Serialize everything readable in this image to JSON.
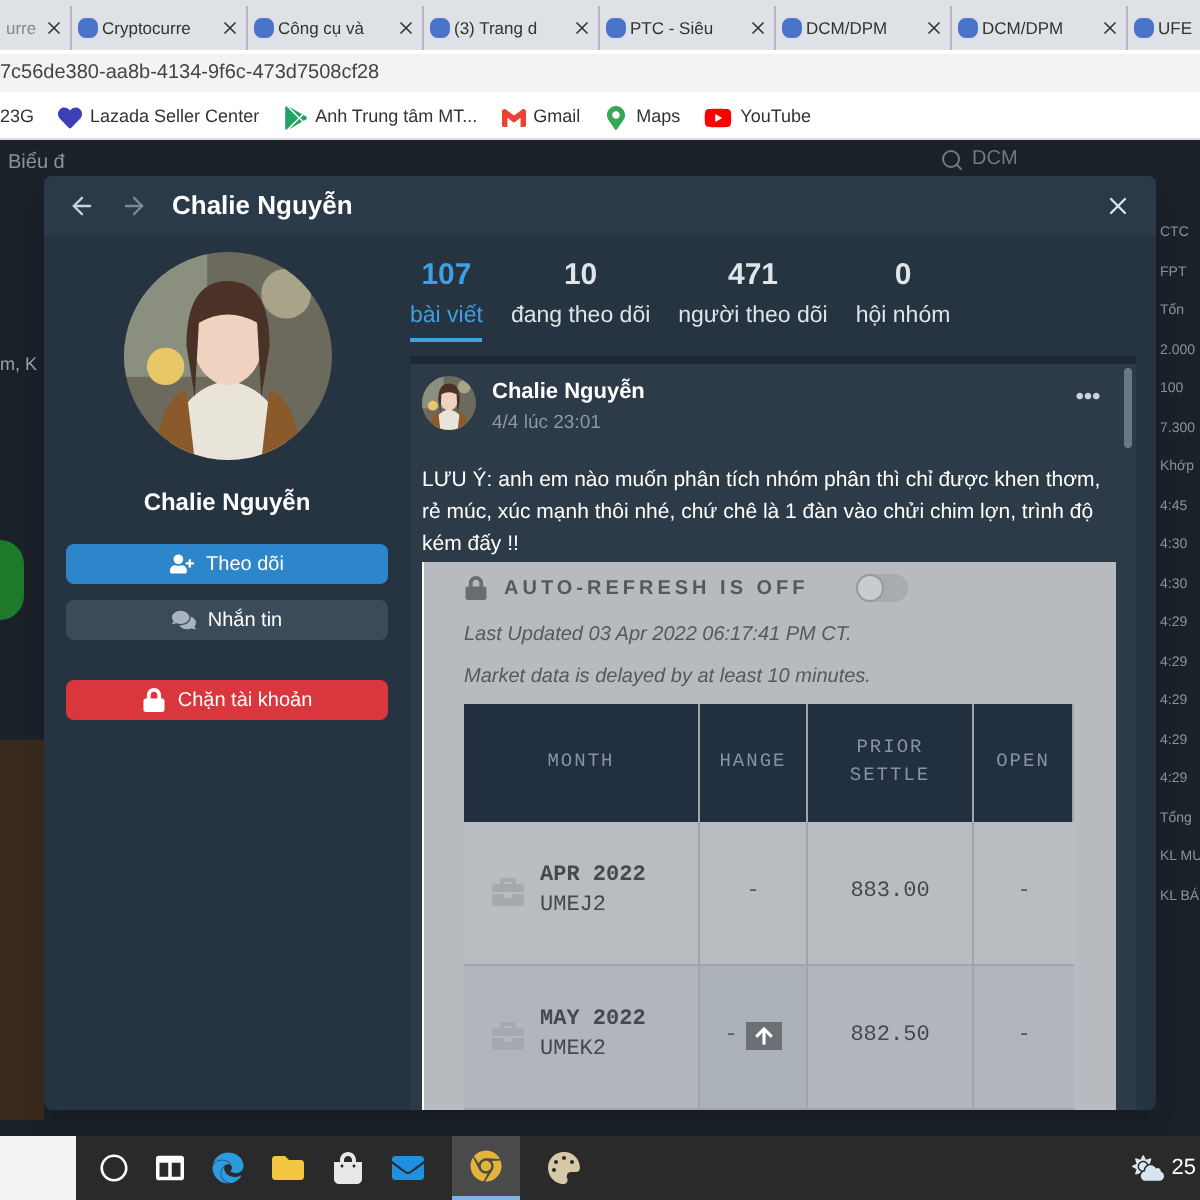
{
  "browser": {
    "tabs": [
      {
        "title": "urre",
        "selected": false
      },
      {
        "title": "Cryptocurre",
        "selected": false
      },
      {
        "title": "Công cụ và",
        "selected": false
      },
      {
        "title": "(3) Trang d",
        "selected": false
      },
      {
        "title": "PTC - Siêu",
        "selected": false
      },
      {
        "title": "DCM/DPM",
        "selected": false
      },
      {
        "title": "DCM/DPM",
        "selected": false
      },
      {
        "title": "UFE",
        "selected": false
      }
    ],
    "address": "7c56de380-aa8b-4134-9f6c-473d7508cf28",
    "bookmarks": [
      {
        "label": "23G",
        "kind": "none"
      },
      {
        "label": "Lazada Seller Center",
        "kind": "heart"
      },
      {
        "label": "Anh Trung tâm MT...",
        "kind": "drive"
      },
      {
        "label": "Gmail",
        "kind": "gmail"
      },
      {
        "label": "Maps",
        "kind": "maps"
      },
      {
        "label": "YouTube",
        "kind": "youtube"
      }
    ]
  },
  "background": {
    "top_left": "Biểu đ",
    "side_text": "m, K",
    "search": "DCM",
    "right_column": [
      "CTC",
      "FPT",
      "Tổn",
      "2.000",
      "100",
      "7.300",
      "Khớp",
      "4:45",
      "4:30",
      "4:30",
      "4:29",
      "4:29",
      "4:29",
      "4:29",
      "4:29",
      "Tổng",
      "KL MU",
      "KL BÁ"
    ]
  },
  "modal": {
    "title": "Chalie Nguyễn",
    "name": "Chalie Nguyễn",
    "buttons": [
      {
        "label": "Theo dõi",
        "kind": "follow"
      },
      {
        "label": "Nhắn tin",
        "kind": "message"
      },
      {
        "label": "Chặn tài khoản",
        "kind": "block"
      }
    ],
    "stats": [
      {
        "value": "107",
        "label": "bài viết",
        "selected": true
      },
      {
        "value": "10",
        "label": "đang theo dõi",
        "selected": false
      },
      {
        "value": "471",
        "label": "người theo dõi",
        "selected": false
      },
      {
        "value": "0",
        "label": "hội nhóm",
        "selected": false
      }
    ],
    "post": {
      "author": "Chalie Nguyễn",
      "time": "4/4 lúc 23:01",
      "text": "LƯU Ý: anh em nào muốn phân tích nhóm phân thì chỉ được khen thơm, rẻ múc, xúc mạnh thôi nhé, chứ chê là 1 đàn vào chửi chim lợn, trình độ kém đấy !!",
      "image": {
        "refresh_label": "AUTO-REFRESH IS OFF",
        "refresh_on": false,
        "updated": "Last Updated 03 Apr 2022 06:17:41 PM CT.",
        "delay": "Market data is delayed by at least 10 minutes.",
        "columns": [
          "MONTH",
          "HANGE",
          "PRIOR SETTLE",
          "OPEN"
        ],
        "rows": [
          {
            "month": "APR 2022",
            "code": "UMEJ2",
            "change": "-",
            "prior": "883.00",
            "open": "-"
          },
          {
            "month": "MAY 2022",
            "code": "UMEK2",
            "change": "-",
            "prior": "882.50",
            "open": "-"
          }
        ]
      }
    }
  },
  "taskbar": {
    "weather": "25"
  }
}
